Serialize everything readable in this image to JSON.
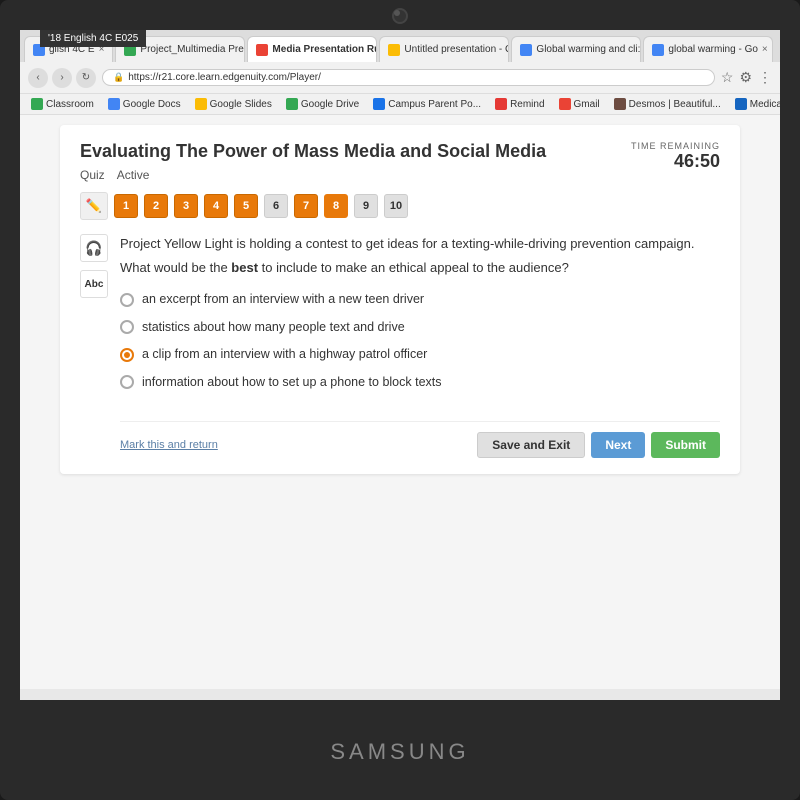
{
  "monitor": {
    "brand": "SAMSUNG"
  },
  "browser": {
    "tabs": [
      {
        "label": "glish 4C E",
        "active": false,
        "icon_color": "#4285f4"
      },
      {
        "label": "Project_Multimedia Pre:",
        "active": false,
        "icon_color": "#34a853"
      },
      {
        "label": "Media Presentation Rub",
        "active": true,
        "icon_color": "#ea4335"
      },
      {
        "label": "Untitled presentation - G",
        "active": false,
        "icon_color": "#fbbc05"
      },
      {
        "label": "Global warming and cli:",
        "active": false,
        "icon_color": "#4285f4"
      },
      {
        "label": "global warming - Go",
        "active": false,
        "icon_color": "#4285f4"
      }
    ],
    "url": "https://r21.core.learn.edgenuity.com/Player/",
    "bookmarks": [
      {
        "label": "Classroom",
        "icon_color": "#34a853"
      },
      {
        "label": "Google Docs",
        "icon_color": "#4285f4"
      },
      {
        "label": "Google Slides",
        "icon_color": "#fbbc05"
      },
      {
        "label": "Google Drive",
        "icon_color": "#34a853"
      },
      {
        "label": "Campus Parent Po...",
        "icon_color": "#1a73e8"
      },
      {
        "label": "Remind",
        "icon_color": "#e53935"
      },
      {
        "label": "Gmail",
        "icon_color": "#ea4335"
      },
      {
        "label": "Desmos | Beautiful...",
        "icon_color": "#6d4c41"
      },
      {
        "label": "Medical Biology - L",
        "icon_color": "#1565c0"
      }
    ]
  },
  "class_label": "'18 English 4C E025",
  "quiz": {
    "title": "Evaluating The Power of Mass Media and Social Media",
    "label": "Quiz",
    "status": "Active",
    "question_numbers": [
      "1",
      "2",
      "3",
      "4",
      "5",
      "6",
      "7",
      "8",
      "9",
      "10"
    ],
    "active_question": 8,
    "time_label": "TIME REMAINING",
    "time_value": "46:50",
    "question_intro": "Project Yellow Light is holding a contest to get ideas for a texting-while-driving prevention campaign.",
    "question_prompt": "What would be the best to include to make an ethical appeal to the audience?",
    "best_word": "best",
    "answers": [
      {
        "text": "an excerpt from an interview with a new teen driver",
        "selected": false
      },
      {
        "text": "statistics about how many people text and drive",
        "selected": false
      },
      {
        "text": "a clip from an interview with a highway patrol officer",
        "selected": true
      },
      {
        "text": "information about how to set up a phone to block texts",
        "selected": false
      }
    ],
    "bottom": {
      "mark_return": "Mark this and return",
      "save_exit": "Save and Exit",
      "next": "Next",
      "submit": "Submit"
    }
  }
}
